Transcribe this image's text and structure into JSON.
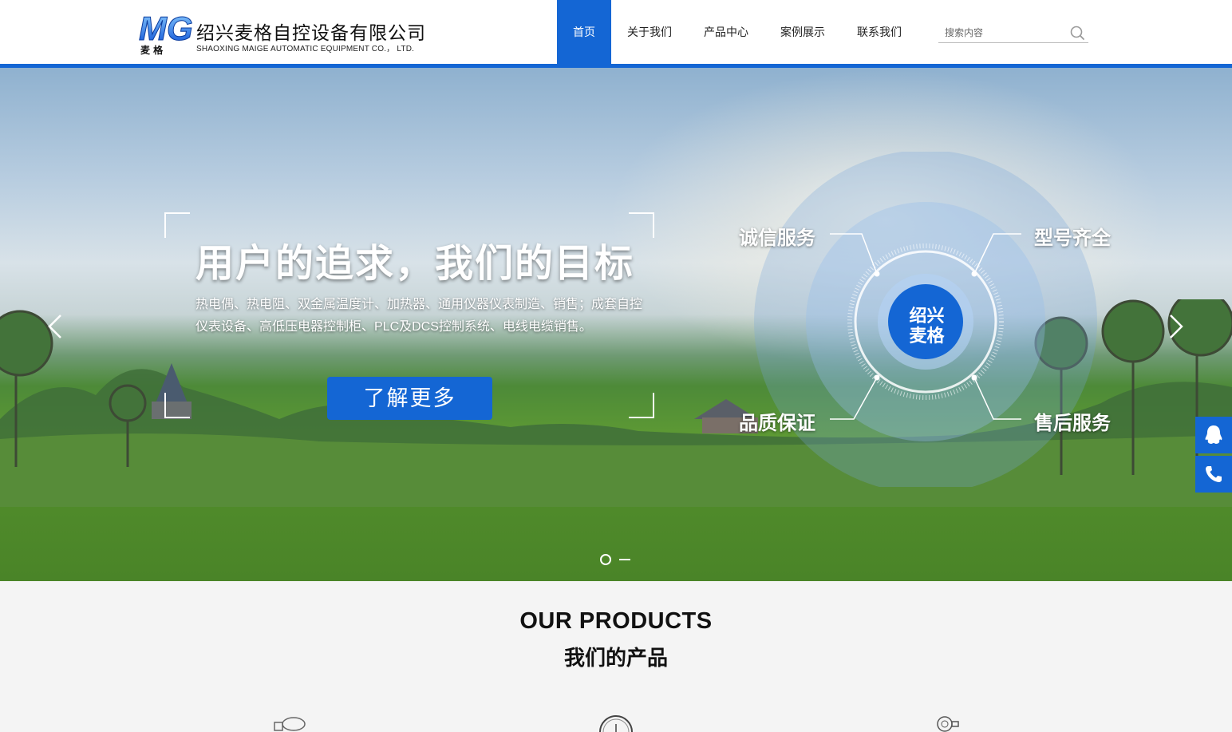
{
  "header": {
    "logo_text": "MG",
    "logo_sub": "麦 格",
    "company_cn": "绍兴麦格自控设备有限公司",
    "company_en": "SHAOXING MAIGE AUTOMATIC EQUIPMENT CO.， LTD."
  },
  "nav": {
    "items": [
      {
        "label": "首页"
      },
      {
        "label": "关于我们"
      },
      {
        "label": "产品中心"
      },
      {
        "label": "案例展示"
      },
      {
        "label": "联系我们"
      }
    ],
    "active_index": 0
  },
  "search": {
    "placeholder": "搜索内容",
    "icon": "search-icon"
  },
  "banner": {
    "headline": "用户的追求，我们的目标",
    "description": "热电偶、热电阻、双金属温度计、加热器、通用仪器仪表制造、销售；成套自控仪表设备、高低压电器控制柜、PLC及DCS控制系统、电线电缆销售。",
    "button_label": "了解更多",
    "orbit_center": "绍兴\n麦格",
    "orbit_labels": [
      "诚信服务",
      "型号齐全",
      "品质保证",
      "售后服务"
    ],
    "slides": 2,
    "current_slide": 1
  },
  "side_buttons": [
    "qq-icon",
    "phone-icon"
  ],
  "products": {
    "title_en": "OUR PRODUCTS",
    "title_cn": "我们的产品"
  },
  "colors": {
    "accent": "#1466d4",
    "header_bg": "#ffffff",
    "section_bg": "#f4f4f4"
  }
}
